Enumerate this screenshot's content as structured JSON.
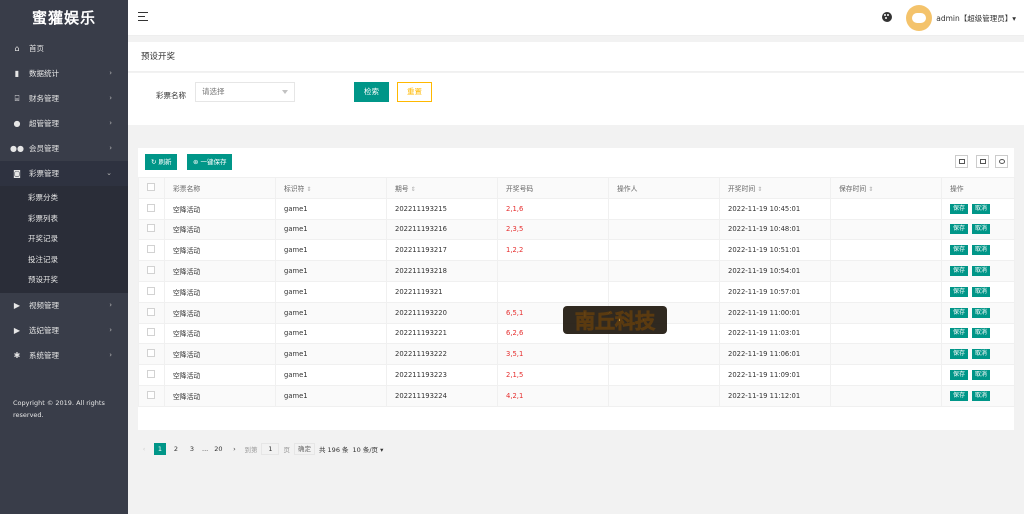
{
  "sidebar": {
    "logo": "蜜獾娱乐",
    "items": [
      {
        "label": "首页"
      },
      {
        "label": "数据统计"
      },
      {
        "label": "财务管理"
      },
      {
        "label": "超管管理"
      },
      {
        "label": "会员管理"
      },
      {
        "label": "彩票管理"
      },
      {
        "label": "视频管理"
      },
      {
        "label": "选妃管理"
      },
      {
        "label": "系统管理"
      }
    ],
    "subitems": [
      "彩票分类",
      "彩票列表",
      "开奖记录",
      "投注记录",
      "预设开奖"
    ],
    "copyright": "Copyright © 2019. All rights reserved."
  },
  "header": {
    "user": "admin【超级管理员】▾"
  },
  "page": {
    "title": "预设开奖",
    "filter_label": "彩票名称",
    "select_placeholder": "请选择",
    "search_label": "检索",
    "reset_label": "重置"
  },
  "toolbar": {
    "refresh_label": "刷新",
    "save_all_label": "一键保存"
  },
  "table": {
    "columns": [
      "彩票名称",
      "标识符",
      "期号",
      "开奖号码",
      "操作人",
      "开奖时间",
      "保存时间",
      "操作"
    ],
    "rows": [
      {
        "name": "空降活动",
        "id": "game1",
        "issue": "202211193215",
        "result": "2,1,6",
        "operator": "",
        "open_time": "2022-11-19 10:45:01",
        "save_time": ""
      },
      {
        "name": "空降活动",
        "id": "game1",
        "issue": "202211193216",
        "result": "2,3,5",
        "operator": "",
        "open_time": "2022-11-19 10:48:01",
        "save_time": ""
      },
      {
        "name": "空降活动",
        "id": "game1",
        "issue": "202211193217",
        "result": "1,2,2",
        "operator": "",
        "open_time": "2022-11-19 10:51:01",
        "save_time": ""
      },
      {
        "name": "空降活动",
        "id": "game1",
        "issue": "202211193218",
        "result": "",
        "operator": "",
        "open_time": "2022-11-19 10:54:01",
        "save_time": ""
      },
      {
        "name": "空降活动",
        "id": "game1",
        "issue": "20221119321",
        "result": "",
        "operator": "",
        "open_time": "2022-11-19 10:57:01",
        "save_time": ""
      },
      {
        "name": "空降活动",
        "id": "game1",
        "issue": "202211193220",
        "result": "6,5,1",
        "operator": "",
        "open_time": "2022-11-19 11:00:01",
        "save_time": ""
      },
      {
        "name": "空降活动",
        "id": "game1",
        "issue": "202211193221",
        "result": "6,2,6",
        "operator": "",
        "open_time": "2022-11-19 11:03:01",
        "save_time": ""
      },
      {
        "name": "空降活动",
        "id": "game1",
        "issue": "202211193222",
        "result": "3,5,1",
        "operator": "",
        "open_time": "2022-11-19 11:06:01",
        "save_time": ""
      },
      {
        "name": "空降活动",
        "id": "game1",
        "issue": "202211193223",
        "result": "2,1,5",
        "operator": "",
        "open_time": "2022-11-19 11:09:01",
        "save_time": ""
      },
      {
        "name": "空降活动",
        "id": "game1",
        "issue": "202211193224",
        "result": "4,2,1",
        "operator": "",
        "open_time": "2022-11-19 11:12:01",
        "save_time": ""
      }
    ],
    "save_label": "保存",
    "cancel_label": "取消"
  },
  "pager": {
    "pages": [
      "1",
      "2",
      "3",
      "...",
      "20"
    ],
    "goto_label": "到第",
    "goto_value": "1",
    "page_unit": "页",
    "confirm_label": "确定",
    "total": "共 196 条",
    "per_page": "10 条/页 ▾"
  },
  "watermark": {
    "text": "南丘科技"
  },
  "colors": {
    "primary": "#009688",
    "sidebar": "#393d49",
    "reset": "#ffb800",
    "number": "#e62e2e"
  }
}
